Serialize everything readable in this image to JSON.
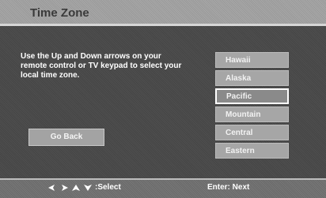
{
  "header": {
    "title": "Time Zone"
  },
  "instructions": "Use the Up and Down arrows on your remote control or TV keypad to select your local time zone.",
  "go_back_label": "Go Back",
  "zones": [
    {
      "label": "Hawaii",
      "selected": false
    },
    {
      "label": "Alaska",
      "selected": false
    },
    {
      "label": "Pacific",
      "selected": true
    },
    {
      "label": "Mountain",
      "selected": false
    },
    {
      "label": "Central",
      "selected": false
    },
    {
      "label": "Eastern",
      "selected": false
    }
  ],
  "footer": {
    "nav_icons": [
      "left-arrow-icon",
      "right-arrow-icon",
      "up-arrow-icon",
      "down-arrow-icon"
    ],
    "select_label": ":Select",
    "enter_label": "Enter: Next"
  }
}
